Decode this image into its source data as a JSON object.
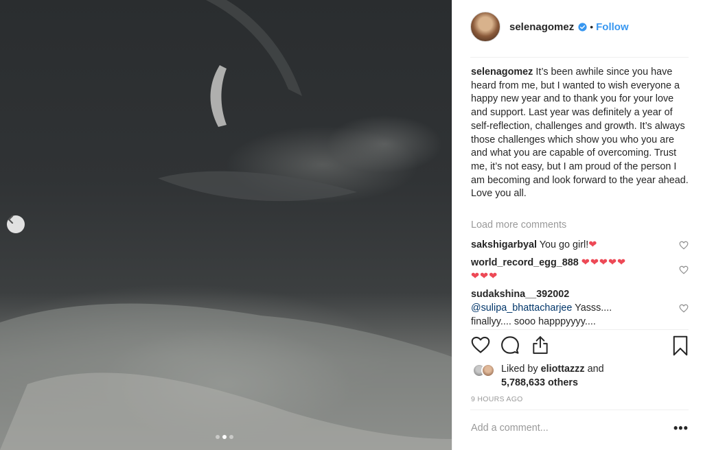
{
  "post": {
    "username": "selenagomez",
    "follow_label": "Follow",
    "separator": "•",
    "caption_text": "It’s been awhile since you have heard from me, but I wanted to wish everyone a happy new year and to thank you for your love and support. Last year was definitely a year of self-reflection, challenges and growth. It’s always those challenges which show you who you are and what you are capable of overcoming. Trust me, it’s not easy, but I am proud of the person I am becoming and look forward to the year ahead. Love you all.",
    "load_more": "Load more comments",
    "comments": [
      {
        "user": "sakshigarbyal",
        "text": "You go girl!",
        "emoji": "❤"
      },
      {
        "user": "world_record_egg_888",
        "text": "",
        "emoji": "❤❤❤❤❤",
        "emoji2": "❤❤❤"
      },
      {
        "user": "sudakshina__392002",
        "mention": "@sulipa_bhattacharjee",
        "text": "Yasss....",
        "text2": "finallyy.... sooo happpyyyy...."
      }
    ],
    "liked_by_prefix": "Liked by",
    "liked_by_user": "eliottazzz",
    "liked_by_and": "and",
    "likes_others": "5,788,633 others",
    "timestamp": "9 HOURS AGO",
    "add_comment_placeholder": "Add a comment...",
    "more_options": "•••"
  },
  "carousel": {
    "slide_count": 3,
    "active_slide": 2
  },
  "colors": {
    "link": "#3897f0",
    "muted": "#999999",
    "text": "#262626",
    "heart": "#ed4956",
    "mention": "#003569"
  },
  "icons": [
    "chevron-left-icon",
    "verified-badge-icon",
    "heart-icon",
    "comment-icon",
    "share-icon",
    "bookmark-icon"
  ]
}
